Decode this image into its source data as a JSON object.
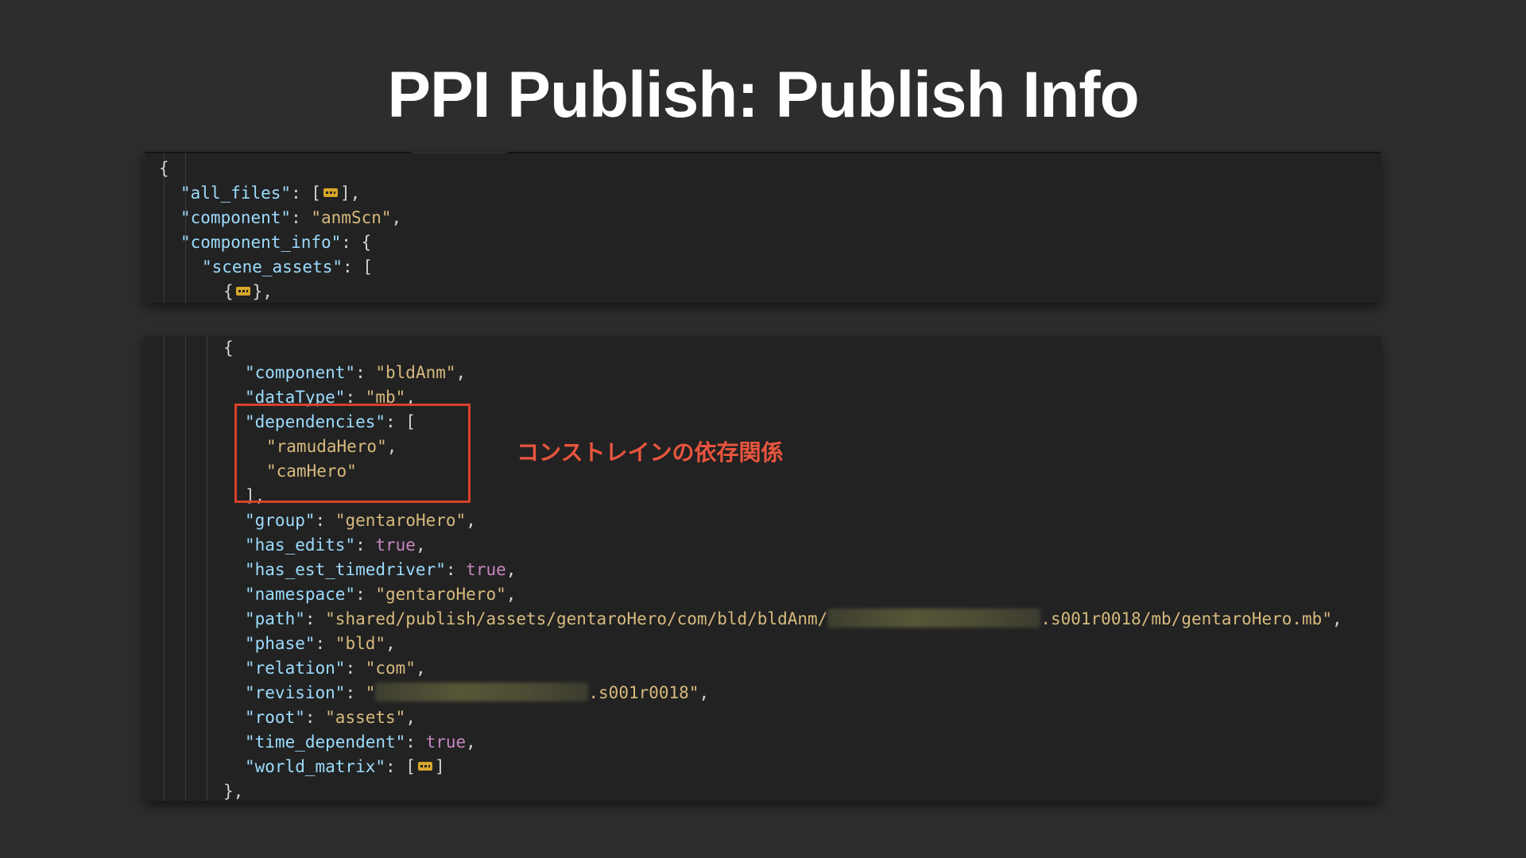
{
  "slide": {
    "title": "PPI Publish: Publish Info",
    "annotation": "コンストレインの依存関係"
  },
  "colors": {
    "background": "#2d2d2d",
    "code_background": "#222222",
    "key": "#9cdcfe",
    "string": "#d7ba7d",
    "boolean": "#c586c0",
    "highlight_box": "#d9412c",
    "annotation": "#e8553e"
  },
  "code_top": [
    {
      "indent": 0,
      "tokens": [
        {
          "c": "p",
          "t": "{"
        }
      ]
    },
    {
      "indent": 1,
      "tokens": [
        {
          "c": "k",
          "t": "\"all_files\""
        },
        {
          "c": "p",
          "t": ": ["
        },
        {
          "c": "fold",
          "icon": "collapsed-fold-icon"
        },
        {
          "c": "p",
          "t": "],"
        }
      ]
    },
    {
      "indent": 1,
      "tokens": [
        {
          "c": "k",
          "t": "\"component\""
        },
        {
          "c": "p",
          "t": ": "
        },
        {
          "c": "s",
          "t": "\"anmScn\""
        },
        {
          "c": "p",
          "t": ","
        }
      ]
    },
    {
      "indent": 1,
      "tokens": [
        {
          "c": "k",
          "t": "\"component_info\""
        },
        {
          "c": "p",
          "t": ": {"
        }
      ]
    },
    {
      "indent": 2,
      "tokens": [
        {
          "c": "k",
          "t": "\"scene_assets\""
        },
        {
          "c": "p",
          "t": ": ["
        }
      ]
    },
    {
      "indent": 3,
      "tokens": [
        {
          "c": "p",
          "t": "{"
        },
        {
          "c": "fold",
          "icon": "collapsed-fold-icon"
        },
        {
          "c": "p",
          "t": "},"
        }
      ]
    }
  ],
  "code_bottom": [
    {
      "indent": 3,
      "tokens": [
        {
          "c": "p",
          "t": "{"
        }
      ]
    },
    {
      "indent": 4,
      "tokens": [
        {
          "c": "k",
          "t": "\"component\""
        },
        {
          "c": "p",
          "t": ": "
        },
        {
          "c": "s",
          "t": "\"bldAnm\""
        },
        {
          "c": "p",
          "t": ","
        }
      ]
    },
    {
      "indent": 4,
      "tokens": [
        {
          "c": "k",
          "t": "\"dataType\""
        },
        {
          "c": "p",
          "t": ": "
        },
        {
          "c": "s",
          "t": "\"mb\""
        },
        {
          "c": "p",
          "t": ","
        }
      ]
    },
    {
      "indent": 4,
      "tokens": [
        {
          "c": "k",
          "t": "\"dependencies\""
        },
        {
          "c": "p",
          "t": ": ["
        }
      ]
    },
    {
      "indent": 5,
      "tokens": [
        {
          "c": "s",
          "t": "\"ramudaHero\""
        },
        {
          "c": "p",
          "t": ","
        }
      ]
    },
    {
      "indent": 5,
      "tokens": [
        {
          "c": "s",
          "t": "\"camHero\""
        }
      ]
    },
    {
      "indent": 4,
      "tokens": [
        {
          "c": "p",
          "t": "],"
        }
      ]
    },
    {
      "indent": 4,
      "tokens": [
        {
          "c": "k",
          "t": "\"group\""
        },
        {
          "c": "p",
          "t": ": "
        },
        {
          "c": "s",
          "t": "\"gentaroHero\""
        },
        {
          "c": "p",
          "t": ","
        }
      ]
    },
    {
      "indent": 4,
      "tokens": [
        {
          "c": "k",
          "t": "\"has_edits\""
        },
        {
          "c": "p",
          "t": ": "
        },
        {
          "c": "b",
          "t": "true"
        },
        {
          "c": "p",
          "t": ","
        }
      ]
    },
    {
      "indent": 4,
      "tokens": [
        {
          "c": "k",
          "t": "\"has_est_timedriver\""
        },
        {
          "c": "p",
          "t": ": "
        },
        {
          "c": "b",
          "t": "true"
        },
        {
          "c": "p",
          "t": ","
        }
      ]
    },
    {
      "indent": 4,
      "tokens": [
        {
          "c": "k",
          "t": "\"namespace\""
        },
        {
          "c": "p",
          "t": ": "
        },
        {
          "c": "s",
          "t": "\"gentaroHero\""
        },
        {
          "c": "p",
          "t": ","
        }
      ]
    },
    {
      "indent": 4,
      "tokens": [
        {
          "c": "k",
          "t": "\"path\""
        },
        {
          "c": "p",
          "t": ": "
        },
        {
          "c": "s",
          "t": "\"shared/publish/assets/gentaroHero/com/bld/bldAnm/"
        },
        {
          "c": "blur",
          "w": 268
        },
        {
          "c": "s",
          "t": ".s001r0018/mb/gentaroHero.mb\""
        },
        {
          "c": "p",
          "t": ","
        }
      ]
    },
    {
      "indent": 4,
      "tokens": [
        {
          "c": "k",
          "t": "\"phase\""
        },
        {
          "c": "p",
          "t": ": "
        },
        {
          "c": "s",
          "t": "\"bld\""
        },
        {
          "c": "p",
          "t": ","
        }
      ]
    },
    {
      "indent": 4,
      "tokens": [
        {
          "c": "k",
          "t": "\"relation\""
        },
        {
          "c": "p",
          "t": ": "
        },
        {
          "c": "s",
          "t": "\"com\""
        },
        {
          "c": "p",
          "t": ","
        }
      ]
    },
    {
      "indent": 4,
      "tokens": [
        {
          "c": "k",
          "t": "\"revision\""
        },
        {
          "c": "p",
          "t": ": "
        },
        {
          "c": "s",
          "t": "\""
        },
        {
          "c": "blur",
          "w": 268
        },
        {
          "c": "s",
          "t": ".s001r0018\""
        },
        {
          "c": "p",
          "t": ","
        }
      ]
    },
    {
      "indent": 4,
      "tokens": [
        {
          "c": "k",
          "t": "\"root\""
        },
        {
          "c": "p",
          "t": ": "
        },
        {
          "c": "s",
          "t": "\"assets\""
        },
        {
          "c": "p",
          "t": ","
        }
      ]
    },
    {
      "indent": 4,
      "tokens": [
        {
          "c": "k",
          "t": "\"time_dependent\""
        },
        {
          "c": "p",
          "t": ": "
        },
        {
          "c": "b",
          "t": "true"
        },
        {
          "c": "p",
          "t": ","
        }
      ]
    },
    {
      "indent": 4,
      "tokens": [
        {
          "c": "k",
          "t": "\"world_matrix\""
        },
        {
          "c": "p",
          "t": ": ["
        },
        {
          "c": "fold",
          "icon": "collapsed-fold-icon"
        },
        {
          "c": "p",
          "t": "]"
        }
      ]
    },
    {
      "indent": 3,
      "tokens": [
        {
          "c": "p",
          "t": "},"
        }
      ]
    }
  ]
}
